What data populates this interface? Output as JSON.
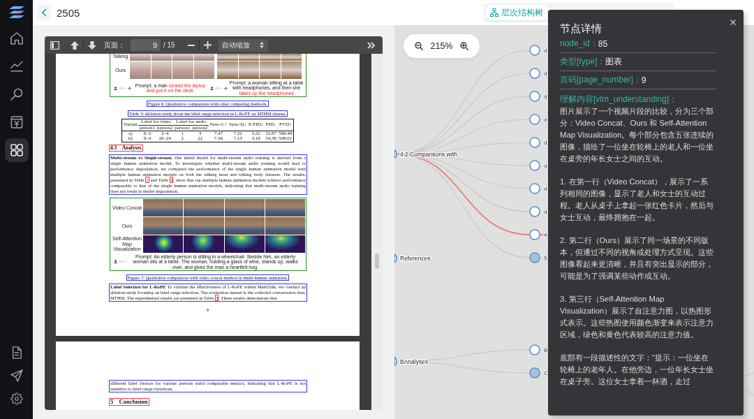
{
  "sidebar": {
    "top_items": [
      {
        "selected": false
      },
      {
        "selected": false
      },
      {
        "selected": false
      },
      {
        "selected": false
      },
      {
        "selected": true
      }
    ],
    "bottom_items": [
      {
        "selected": false
      },
      {
        "selected": false
      },
      {
        "selected": false
      }
    ]
  },
  "header": {
    "title": "2505",
    "view_tabs": [
      {
        "label": "层次结构树",
        "selected": true
      }
    ]
  },
  "pdf_viewer": {
    "toolbar": {
      "page_label": "页面：",
      "page_value": "9",
      "page_total": "/ 15",
      "zoom_mode": "自动缩放"
    },
    "pages": [
      {
        "blocks": [
          {
            "kind": "figure",
            "cut_top": true,
            "rows": [
              {
                "kind": "photos",
                "label": "Talking"
              },
              {
                "kind": "photos",
                "label": "Ours"
              }
            ],
            "prompts": [
              "Prompt: a man **closed the laptop and put it on the desk.**",
              "Prompt: a woman sitting at a table with headphones, and then she **takes up the headphones**"
            ]
          },
          {
            "kind": "caption",
            "text": "Figure 6: Qualitative comparison with other competing methods."
          },
          {
            "kind": "caption",
            "text": "Table 3: Ablation study about the label range selection in L-RoPE on MTHM dataset."
          },
          {
            "kind": "table",
            "variant": "Variant",
            "groups": [
              {
                "label": "Label for video",
                "subs": [
                  "person1",
                  "person2"
                ]
              },
              {
                "label": "Label for audio",
                "subs": [
                  "person1",
                  "person2"
                ]
              }
            ],
            "metrics": [
              "Sync-C↑",
              "Sync-D↓",
              "E-FID↓",
              "FID↓",
              "FVD↓"
            ],
            "rows": [
              [
                "a)",
                "0–2",
                "2–4",
                "1",
                "3",
                "7.47",
                "7.22",
                "3.22",
                "52.87",
                "506.49"
              ],
              [
                "b)",
                "0–4",
                "20–24",
                "2",
                "22",
                "7.56",
                "7.13",
                "3.16",
                "54.30",
                "508.01"
              ]
            ]
          },
          {
            "kind": "subheading",
            "number": "4.3",
            "title": "Analyses"
          },
          {
            "kind": "paragraph",
            "parts": [
              {
                "text": "**Multi-stream vs Single-stream.** Our initial model for multi-stream audio training is derived from a single human animation model. To investigate whether multi-stream audio training would lead to performance degradation, we compared the performance of the single human animation model with multiple human animation models on both the talking head and talking body datasets. The results, presented in Table "
              },
              {
                "link": "1"
              },
              {
                "text": " and Table "
              },
              {
                "link": "2"
              },
              {
                "text": ", show that our multiple human animation models achieve performance comparable to that of the single human animation models, indicating that multi-stream audio training does not result in model degradation."
              }
            ]
          },
          {
            "kind": "figure",
            "cut_top": false,
            "rows": [
              {
                "kind": "photos",
                "label": "Video Concat"
              },
              {
                "kind": "photos",
                "label": "Ours"
              },
              {
                "kind": "heatmap",
                "label": "Self-Attention Map Visualization"
              }
            ],
            "prompts": [
              "Prompt: An elderly person is sitting in a wheelchair. Beside him, an elderly woman sits at a table. The woman, holding a glass of wine, stands up, walks over, and gives the man a heartfelt hug."
            ]
          },
          {
            "kind": "caption",
            "text": "Figure 7: Qualitative comparison with video concat method in multi-human animation."
          },
          {
            "kind": "paragraph",
            "parts": [
              {
                "text": "**Label Selection for L-RoPE** To validate the effectiveness of L-RoPE within MultiTalk, we conduct an ablation study focusing on label range selection. The evaluation dataset is the collected conversation data, MTHM. The experimental results are presented in Table "
              },
              {
                "link": "3"
              },
              {
                "text": ". These results demonstrate that"
              }
            ]
          }
        ],
        "page_number": "9"
      },
      {
        "blocks": [
          {
            "kind": "paragraph",
            "parts": [
              {
                "text": "different label choices for various persons yield comparable metrics, indicating that L-RoPE is not sensitive to label range variations."
              }
            ]
          },
          {
            "kind": "heading",
            "number": "5",
            "title": "Conclusion"
          },
          {
            "kind": "cut_block"
          }
        ]
      }
    ]
  },
  "tree": {
    "zoom": "215%",
    "nodes": [
      {
        "label": "4.2 Comparisons with...",
        "collapsed": false,
        "children": [
          {
            "label": "d",
            "collapsed": false,
            "highlighted": false
          },
          {
            "label": "d",
            "collapsed": false,
            "highlighted": false
          },
          {
            "label": "d",
            "collapsed": false,
            "highlighted": false
          },
          {
            "label": "d",
            "collapsed": false,
            "highlighted": false
          },
          {
            "label": "d",
            "collapsed": false,
            "highlighted": false
          },
          {
            "label": "d",
            "collapsed": false,
            "highlighted": false
          },
          {
            "label": "d",
            "collapsed": false,
            "highlighted": false
          },
          {
            "label": "d",
            "collapsed": false,
            "highlighted": false
          },
          {
            "label": "4",
            "collapsed": false,
            "highlighted": true
          },
          {
            "label": "5",
            "collapsed": true,
            "highlighted": false
          }
        ]
      },
      {
        "label": "References",
        "collapsed": false
      },
      {
        "label": "BAnalyses",
        "collapsed": false,
        "children": [
          {
            "label": "B",
            "collapsed": false,
            "highlighted": false
          },
          {
            "label": "C",
            "collapsed": true,
            "highlighted": false
          }
        ]
      }
    ]
  },
  "detail_panel": {
    "title": "节点详情",
    "fields": [
      {
        "label": "node_id：",
        "value": "85"
      },
      {
        "label": "类型[type]：",
        "value": "图表"
      },
      {
        "label": "页码[page_number]：",
        "value": "9"
      }
    ],
    "understanding": {
      "label": "理解内容[vlm_understanding]：",
      "paragraphs": [
        "图片展示了一个视频片段的比较，分为三个部分：Video Concat、Ours 和 Self-Attention Map Visualization。每个部分包含五张连续的图像，描绘了一位坐在轮椅上的老人和一位坐在桌旁的年长女士之间的互动。",
        "1. 在第一行（Video Concat），展示了一系列相同的图像，显示了老人和女士的互动过程。老人从桌子上拿起一张红色卡片，然后与女士互动，最终拥抱在一起。",
        "2. 第二行（Ours）展示了同一场景的不同版本，但通过不同的视角或处理方式呈现。这些图像看起来更清晰，并且有突出显示的部分，可能是为了强调某些动作或互动。",
        "3. 第三行（Self-Attention Map Visualization）展示了自注意力图，以热图形式表示。这些热图使用颜色渐变来表示注意力区域，绿色和黄色代表较高的注意力值。",
        "底部有一段描述性的文字：“提示：一位坐在轮椅上的老年人。在他旁边，一位年长女士坐在桌子旁。这位女士拿着一杯酒，走过"
      ]
    }
  }
}
